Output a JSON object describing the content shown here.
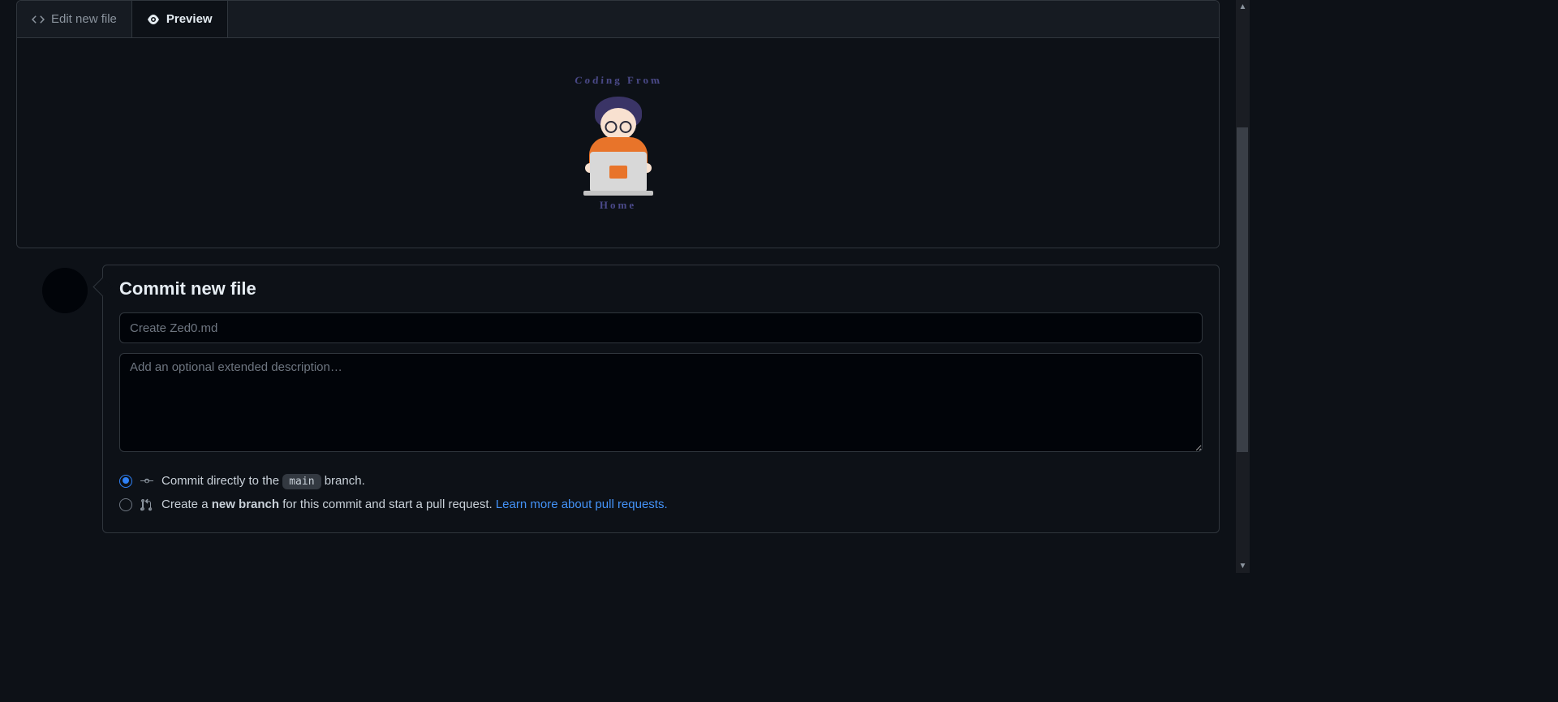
{
  "tabs": {
    "edit_label": "Edit new file",
    "preview_label": "Preview"
  },
  "preview": {
    "illustration_top": "Coding From",
    "illustration_bottom": "Home"
  },
  "commit": {
    "heading": "Commit new file",
    "summary_placeholder": "Create Zed0.md",
    "description_placeholder": "Add an optional extended description…",
    "radio1_prefix": "Commit directly to the ",
    "radio1_branch": "main",
    "radio1_suffix": " branch.",
    "radio2_prefix": "Create a ",
    "radio2_bold": "new branch",
    "radio2_middle": " for this commit and start a pull request. ",
    "radio2_link": "Learn more about pull requests.",
    "selected_option": "direct"
  }
}
